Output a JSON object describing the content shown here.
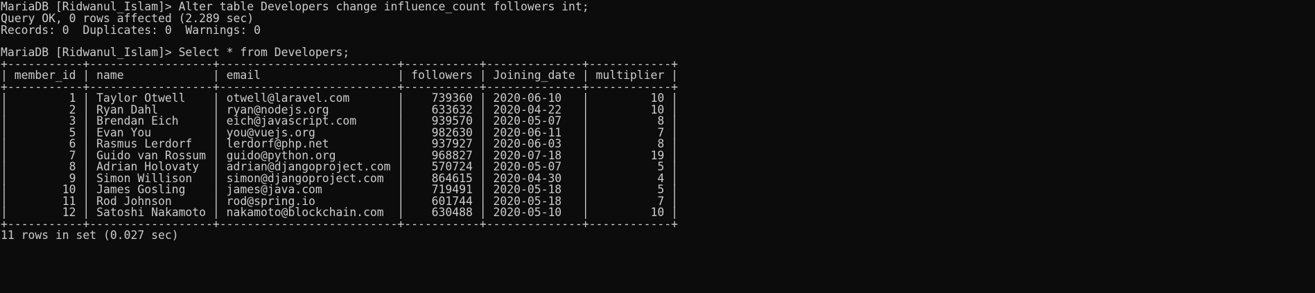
{
  "terminal": {
    "lines": [
      "MariaDB [Ridwanul_Islam]> Alter table Developers change influence_count followers int;",
      "Query OK, 0 rows affected (2.289 sec)",
      "Records: 0  Duplicates: 0  Warnings: 0",
      "",
      "MariaDB [Ridwanul_Islam]> Select * from Developers;",
      "+-----------+------------------+--------------------------+-----------+--------------+------------+",
      "| member_id | name             | email                    | followers | Joining_date | multiplier |",
      "+-----------+------------------+--------------------------+-----------+--------------+------------+",
      "|         1 | Taylor Otwell    | otwell@laravel.com       |    739360 | 2020-06-10   |         10 |",
      "|         2 | Ryan Dahl        | ryan@nodejs.org          |    633632 | 2020-04-22   |         10 |",
      "|         3 | Brendan Eich     | eich@javascript.com      |    939570 | 2020-05-07   |          8 |",
      "|         5 | Evan You         | you@vuejs.org            |    982630 | 2020-06-11   |          7 |",
      "|         6 | Rasmus Lerdorf   | lerdorf@php.net          |    937927 | 2020-06-03   |          8 |",
      "|         7 | Guido van Rossum | guido@python.org         |    968827 | 2020-07-18   |         19 |",
      "|         8 | Adrian Holovaty  | adrian@djangoproject.com |    570724 | 2020-05-07   |          5 |",
      "|         9 | Simon Willison   | simon@djangoproject.com  |    864615 | 2020-04-30   |          4 |",
      "|        10 | James Gosling    | james@java.com           |    719491 | 2020-05-18   |          5 |",
      "|        11 | Rod Johnson      | rod@spring.io            |    601744 | 2020-05-18   |          7 |",
      "|        12 | Satoshi Nakamoto | nakamoto@blockchain.com  |    630488 | 2020-05-10   |         10 |",
      "+-----------+------------------+--------------------------+-----------+--------------+------------+",
      "11 rows in set (0.027 sec)"
    ]
  }
}
